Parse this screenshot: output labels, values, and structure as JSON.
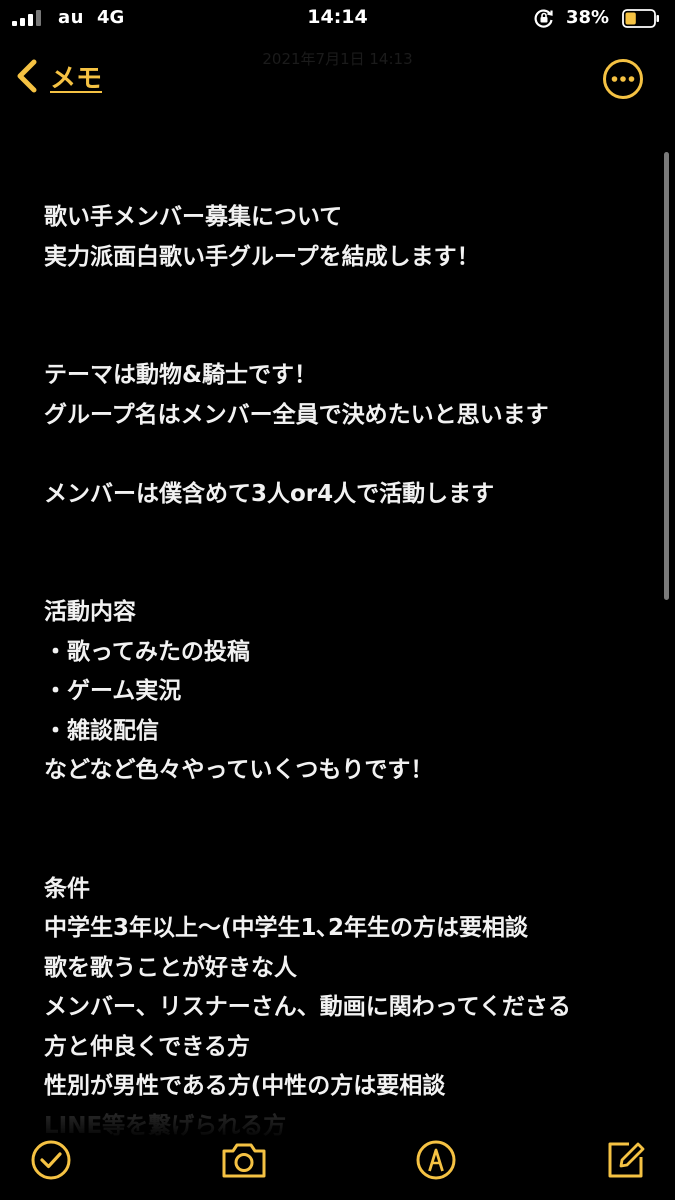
{
  "status_bar": {
    "carrier": "au",
    "network": "4G",
    "time": "14:14",
    "battery_percent": "38%",
    "battery_level": 0.38
  },
  "nav": {
    "back_label": "メモ",
    "date": "2021年7月1日 14:13"
  },
  "note": {
    "lines": [
      "歌い手メンバー募集について",
      "実力派面白歌い手グループを結成します！",
      "",
      "",
      "テーマは動物&騎士です！",
      "グループ名はメンバー全員で決めたいと思います",
      "",
      "メンバーは僕含めて3人or4人で活動します",
      "",
      "",
      "活動内容",
      "・歌ってみたの投稿",
      "・ゲーム実況",
      "・雑談配信",
      "などなど色々やっていくつもりです！",
      "",
      "",
      "条件",
      "中学生3年以上〜(中学生1､2年生の方は要相談",
      "歌を歌うことが好きな人",
      "メンバー、リスナーさん、動画に関わってくださる",
      "方と仲良くできる方",
      "性別が男性である方(中性の方は要相談",
      "LINE等を繋げられる方"
    ]
  },
  "toolbar": {
    "checklist": "checklist-icon",
    "camera": "camera-icon",
    "markup": "markup-pen-icon",
    "compose": "compose-icon"
  },
  "colors": {
    "accent": "#f5c243",
    "background": "#000000",
    "text": "#f2f2f2"
  }
}
